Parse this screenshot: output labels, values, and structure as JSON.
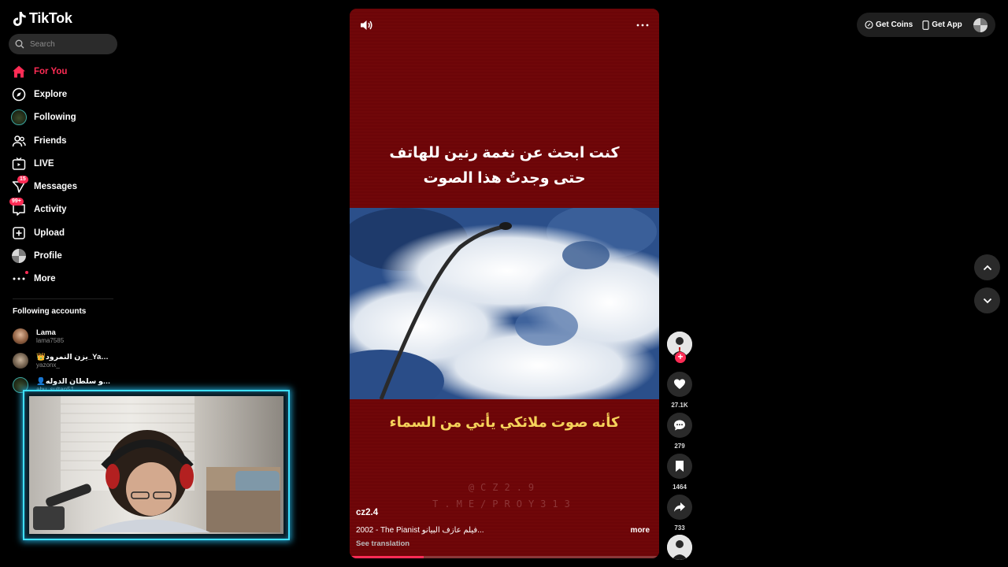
{
  "brand": {
    "name": "TikTok"
  },
  "search": {
    "placeholder": "Search"
  },
  "nav": {
    "items": [
      {
        "label": "For You",
        "icon": "home-icon",
        "active": true
      },
      {
        "label": "Explore",
        "icon": "compass-icon"
      },
      {
        "label": "Following",
        "icon": "following-avatar-icon"
      },
      {
        "label": "Friends",
        "icon": "friends-icon"
      },
      {
        "label": "LIVE",
        "icon": "live-icon"
      },
      {
        "label": "Messages",
        "icon": "messages-icon",
        "badge": "15"
      },
      {
        "label": "Activity",
        "icon": "activity-icon",
        "badge": "99+"
      },
      {
        "label": "Upload",
        "icon": "upload-icon"
      },
      {
        "label": "Profile",
        "icon": "profile-icon"
      },
      {
        "label": "More",
        "icon": "more-icon"
      }
    ]
  },
  "following": {
    "title": "Following accounts",
    "accounts": [
      {
        "name": "Lama",
        "handle": "lama7585"
      },
      {
        "name": "👑يزن النمرود_Yazon...",
        "handle": "yazonx_"
      },
      {
        "name": "👤أبو سلطان الدوله)...",
        "handle": "abu_sultan51"
      }
    ]
  },
  "video": {
    "caption_top_line1": "كنت ابحث عن نغمة رنين للهاتف",
    "caption_top_line2": "حتى وجدتُ هذا الصوت",
    "caption_bottom": "كأنه صوت ملائكي يأتي من السماء",
    "watermark_line1": "@CZ2.9",
    "watermark_line2": "T.ME/PROY313",
    "author": "cz2.4",
    "description": "2002 - The Pianist فيلم عازف البيانو...",
    "more_label": "more",
    "see_translation": "See translation",
    "progress": 0.24
  },
  "actions": {
    "likes": "27.1K",
    "comments": "279",
    "saves": "1464",
    "shares": "733"
  },
  "topbar": {
    "get_coins": "Get Coins",
    "get_app": "Get App"
  },
  "colors": {
    "accent": "#fe2c55",
    "video_bg": "#6d0609",
    "webcam_border": "#3ee0ff",
    "caption_yellow": "#f5d25a"
  }
}
